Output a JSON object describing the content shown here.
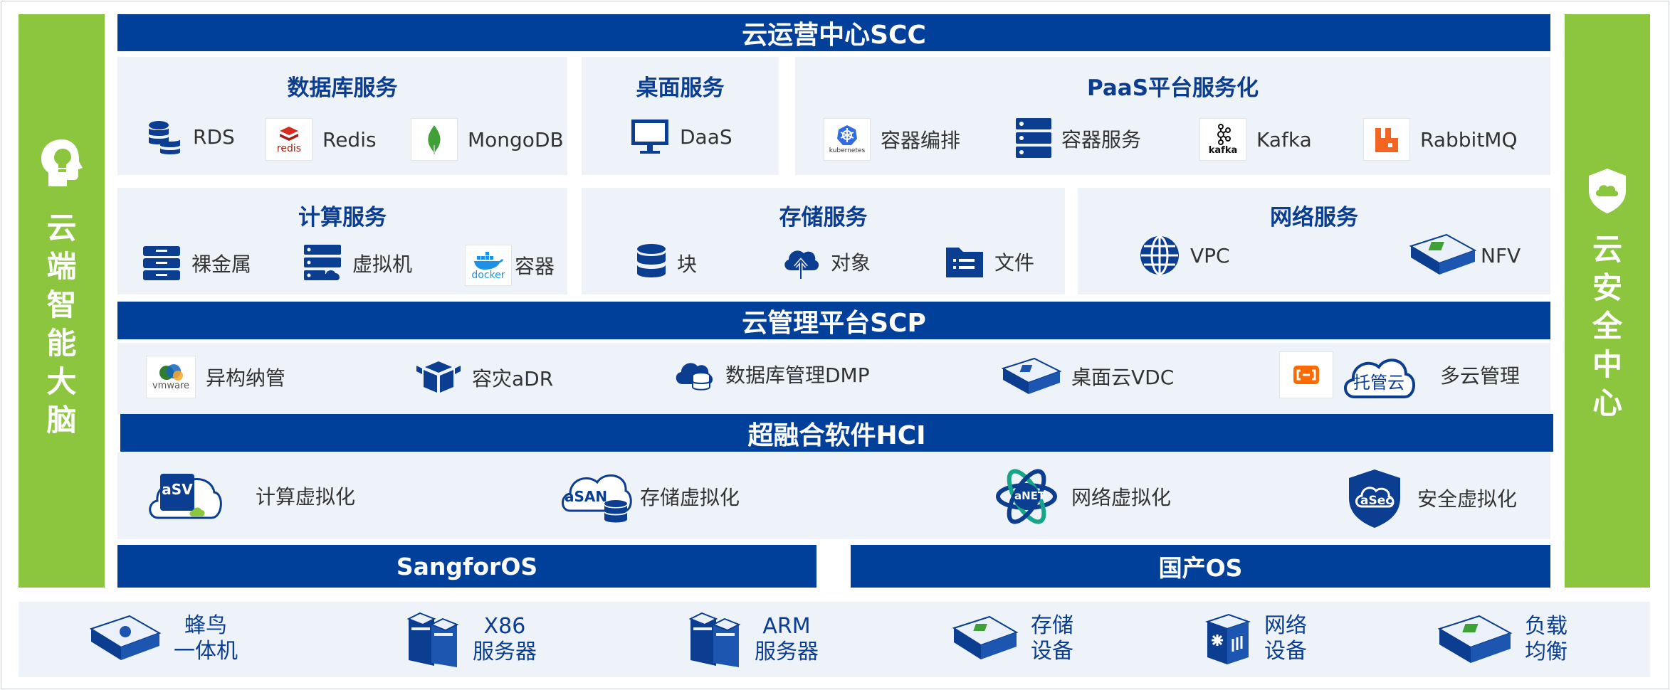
{
  "left_sidebar": {
    "title_chars": [
      "云",
      "端",
      "智",
      "能",
      "大",
      "脑"
    ],
    "icon": "brain-head-icon"
  },
  "right_sidebar": {
    "title_chars": [
      "云",
      "安",
      "全",
      "中",
      "心"
    ],
    "icon": "shield-cloud-icon"
  },
  "scc_bar": {
    "title": "云运营中心SCC"
  },
  "database_panel": {
    "title": "数据库服务",
    "items": [
      {
        "label": "RDS",
        "icon": "database-stack-icon"
      },
      {
        "label": "Redis",
        "icon": "redis-logo-icon",
        "icon_text": "redis"
      },
      {
        "label": "MongoDB",
        "icon": "mongodb-leaf-icon"
      }
    ]
  },
  "desktop_panel": {
    "title": "桌面服务",
    "items": [
      {
        "label": "DaaS",
        "icon": "monitor-icon"
      }
    ]
  },
  "paas_panel": {
    "title": "PaaS平台服务化",
    "items": [
      {
        "label": "容器编排",
        "icon": "kubernetes-icon",
        "icon_text": "kubernetes"
      },
      {
        "label": "容器服务",
        "icon": "server-stack-icon"
      },
      {
        "label": "Kafka",
        "icon": "kafka-logo-icon",
        "icon_text": "kafka"
      },
      {
        "label": "RabbitMQ",
        "icon": "rabbitmq-logo-icon"
      }
    ]
  },
  "compute_panel": {
    "title": "计算服务",
    "items": [
      {
        "label": "裸金属",
        "icon": "bare-metal-icon"
      },
      {
        "label": "虚拟机",
        "icon": "virtual-machine-icon"
      },
      {
        "label": "容器",
        "icon": "docker-logo-icon",
        "icon_text": "docker"
      }
    ]
  },
  "storage_panel": {
    "title": "存储服务",
    "items": [
      {
        "label": "块",
        "icon": "block-storage-icon"
      },
      {
        "label": "对象",
        "icon": "cloud-upload-icon"
      },
      {
        "label": "文件",
        "icon": "folder-icon"
      }
    ]
  },
  "network_panel": {
    "title": "网络服务",
    "items": [
      {
        "label": "VPC",
        "icon": "globe-icon"
      },
      {
        "label": "NFV",
        "icon": "network-appliance-icon"
      }
    ]
  },
  "scp_bar": {
    "title": "云管理平台SCP"
  },
  "scp_panel": {
    "items": [
      {
        "label": "异构纳管",
        "icon": "vmware-logo-icon",
        "icon_text": "vmware"
      },
      {
        "label": "容灾aDR",
        "icon": "cubes-icon"
      },
      {
        "label": "数据库管理DMP",
        "icon": "cloud-database-icon"
      },
      {
        "label": "桌面云VDC",
        "icon": "vdc-appliance-icon"
      },
      {
        "label": "多云管理",
        "icon": "multi-cloud-icon",
        "icon_text": "托管云"
      }
    ]
  },
  "hci_bar": {
    "title": "超融合软件HCI"
  },
  "hci_panel": {
    "items": [
      {
        "label": "计算虚拟化",
        "icon": "asv-icon",
        "icon_text": "aSV"
      },
      {
        "label": "存储虚拟化",
        "icon": "asan-icon",
        "icon_text": "aSAN"
      },
      {
        "label": "网络虚拟化",
        "icon": "anet-icon",
        "icon_text": "aNET"
      },
      {
        "label": "安全虚拟化",
        "icon": "asec-icon",
        "icon_text": "aSec"
      }
    ]
  },
  "os_bars": {
    "sangfor": "SangforOS",
    "domestic": "国产OS"
  },
  "hardware": [
    {
      "line1": "蜂鸟",
      "line2": "一体机",
      "icon": "appliance-icon"
    },
    {
      "line1": "X86",
      "line2": "服务器",
      "icon": "tower-server-icon"
    },
    {
      "line1": "ARM",
      "line2": "服务器",
      "icon": "tower-server-icon"
    },
    {
      "line1": "存储",
      "line2": "设备",
      "icon": "storage-appliance-icon"
    },
    {
      "line1": "网络",
      "line2": "设备",
      "icon": "network-switch-icon"
    },
    {
      "line1": "负载",
      "line2": "均衡",
      "icon": "load-balancer-icon"
    }
  ],
  "colors": {
    "brand_blue": "#003f9a",
    "green": "#8cc63f",
    "panel": "#eef3f9",
    "title_blue": "#0b3d91"
  }
}
